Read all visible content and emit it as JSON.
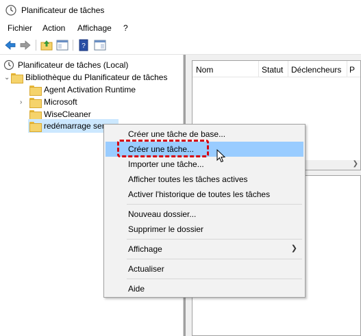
{
  "window": {
    "title": "Planificateur de tâches"
  },
  "menubar": {
    "items": [
      "Fichier",
      "Action",
      "Affichage",
      "?"
    ]
  },
  "tree": {
    "root": "Planificateur de tâches (Local)",
    "library": "Bibliothèque du Planificateur de tâches",
    "children": [
      "Agent Activation Runtime",
      "Microsoft",
      "WiseCleaner",
      "redémarrage ser"
    ]
  },
  "list": {
    "columns": [
      "Nom",
      "Statut",
      "Déclencheurs",
      "P"
    ]
  },
  "context_menu": {
    "items": [
      "Créer une tâche de base...",
      "Créer une tâche...",
      "Importer une tâche...",
      "Afficher toutes les tâches actives",
      "Activer l'historique de toutes les tâches",
      "Nouveau dossier...",
      "Supprimer le dossier",
      "Affichage",
      "Actualiser",
      "Aide"
    ],
    "highlighted_index": 1,
    "highlight_color": "#99ccff",
    "annotation_color": "#d6000f"
  },
  "icons": {
    "app": "task-scheduler-clock-icon",
    "back": "back-arrow-icon",
    "forward": "forward-arrow-icon"
  }
}
